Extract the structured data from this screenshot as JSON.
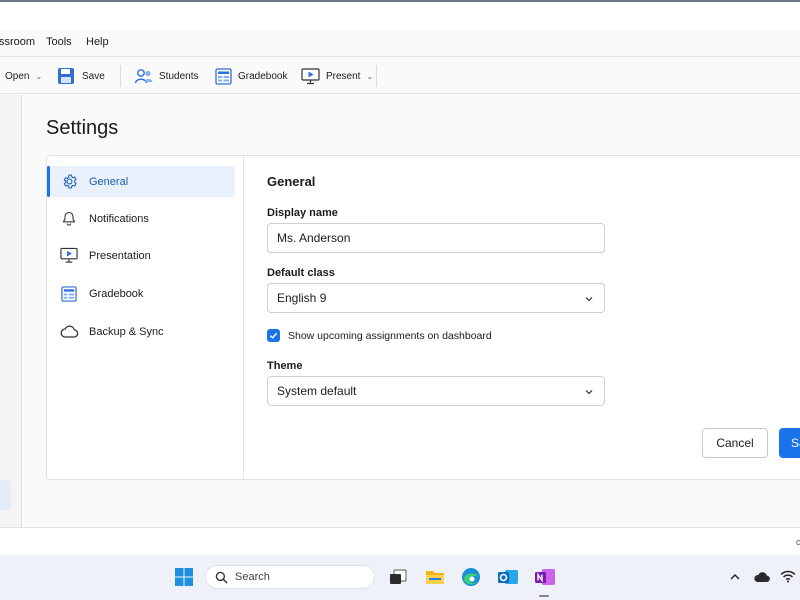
{
  "menubar": {
    "items": [
      "ssroom",
      "Tools",
      "Help"
    ]
  },
  "toolbar": {
    "open_label": "Open",
    "save_label": "Save",
    "students_label": "Students",
    "gradebook_label": "Gradebook",
    "present_label": "Present"
  },
  "page": {
    "title": "Settings"
  },
  "nav": {
    "items": [
      {
        "label": "General",
        "icon": "gear-icon",
        "active": true
      },
      {
        "label": "Notifications",
        "icon": "bell-icon"
      },
      {
        "label": "Presentation",
        "icon": "presentation-icon"
      },
      {
        "label": "Gradebook",
        "icon": "gradebook-icon"
      },
      {
        "label": "Backup & Sync",
        "icon": "cloud-icon"
      }
    ]
  },
  "general": {
    "title": "General",
    "display_name_label": "Display name",
    "display_name_value": "Ms. Anderson",
    "default_class_label": "Default class",
    "default_class_value": "English 9",
    "show_upcoming_label": "Show upcoming assignments on dashboard",
    "show_upcoming_checked": true,
    "theme_label": "Theme",
    "theme_value": "System default"
  },
  "actions": {
    "cancel_label": "Cancel",
    "save_label": "Sa"
  },
  "statusbar": {
    "right_text": "c"
  },
  "taskbar": {
    "search_placeholder": "Search",
    "apps": [
      "start-icon",
      "search-icon",
      "task-view-icon",
      "file-explorer-icon",
      "edge-icon",
      "outlook-icon",
      "onenote-icon"
    ],
    "tray": [
      "chevron-up-icon",
      "onedrive-icon",
      "wifi-icon"
    ]
  },
  "colors": {
    "accent": "#1a73e8",
    "active_bg": "#e9f1fc",
    "taskbar_bg": "#eef2f8"
  }
}
